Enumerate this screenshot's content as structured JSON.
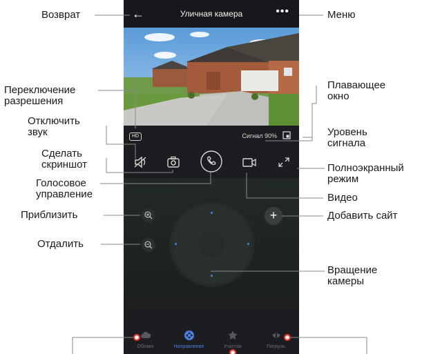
{
  "screen": {
    "title": "Уличная камера",
    "back_icon": "arrow-left-icon",
    "menu_icon": "more-dots-icon",
    "hd_badge": "HD",
    "signal_label": "Сигнал",
    "signal_value": "90%",
    "tabs": [
      {
        "label": "Облако",
        "icon": "cloud-icon"
      },
      {
        "label": "Направление",
        "icon": "direction-icon"
      },
      {
        "label": "Участок",
        "icon": "star-icon"
      },
      {
        "label": "Патруль",
        "icon": "patrol-icon"
      }
    ],
    "active_tab": "Направление",
    "accent_color": "#4d7fe0"
  },
  "annotations": {
    "back": "Возврат",
    "menu": "Меню",
    "resolution": [
      "Переключение",
      "разрешения"
    ],
    "floating": [
      "Плавающее",
      "окно"
    ],
    "mute": [
      "Отключить",
      "звук"
    ],
    "signal": [
      "Уровень",
      "сигнала"
    ],
    "screenshot": [
      "Сделать",
      "скриншот"
    ],
    "fullscreen": [
      "Полноэкранный",
      "режим"
    ],
    "voice": [
      "Голосовое",
      "управление"
    ],
    "video": "Видео",
    "zoom_in": "Приблизить",
    "add_site": "Добавить сайт",
    "zoom_out": "Отдалить",
    "rotate": [
      "Вращение",
      "камеры"
    ]
  }
}
